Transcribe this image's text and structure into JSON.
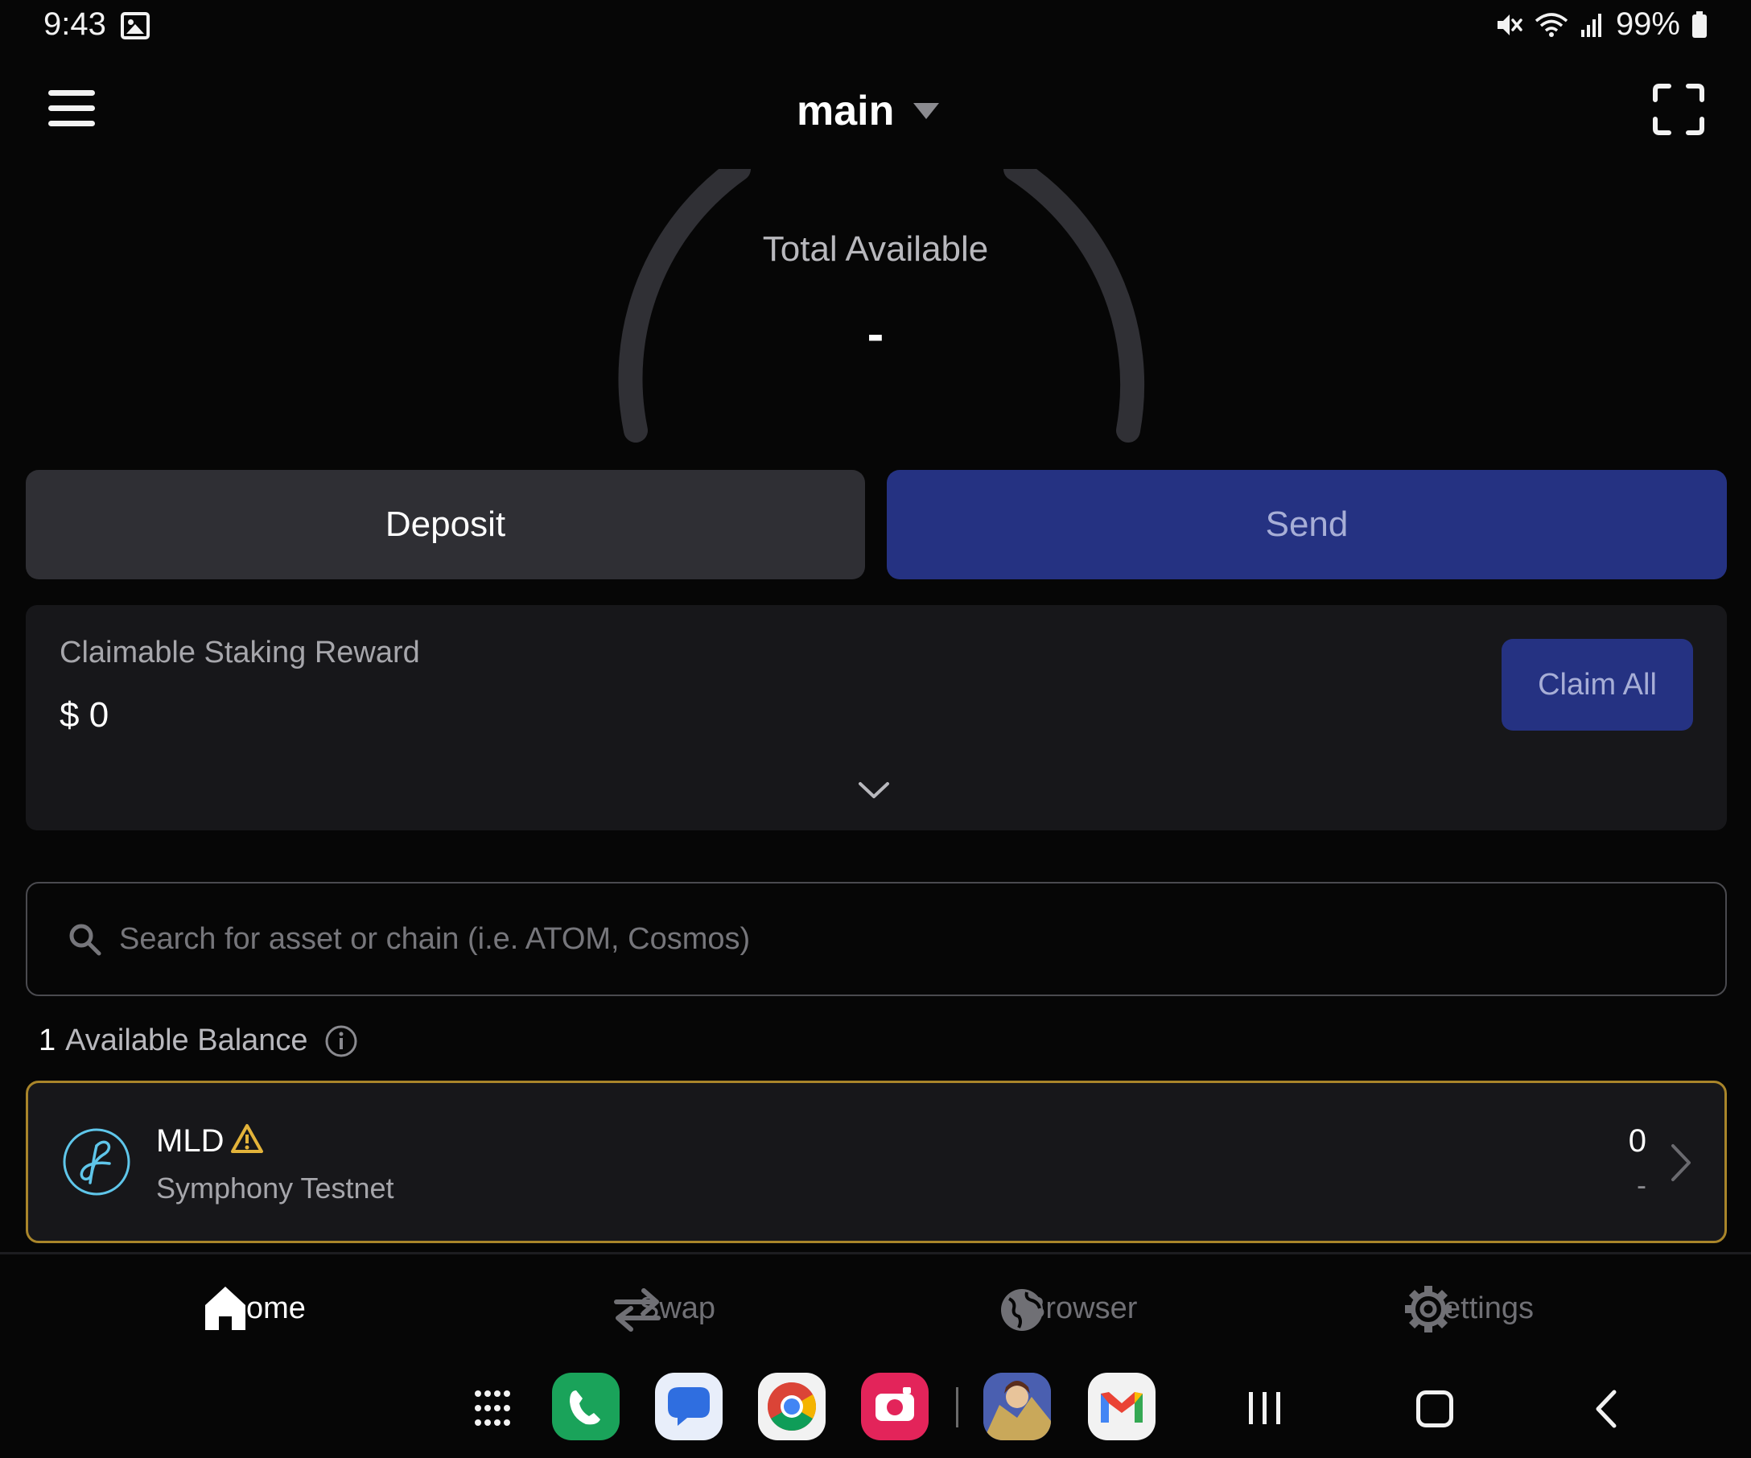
{
  "status_bar": {
    "time": "9:43",
    "battery": "99%",
    "icons": [
      "image-icon",
      "mute-icon",
      "wifi-icon",
      "signal-icon",
      "battery-icon"
    ]
  },
  "header": {
    "account_name": "main",
    "menu_icon": "hamburger-menu-icon",
    "scan_icon": "scan-qr-icon"
  },
  "summary": {
    "total_label": "Total Available",
    "total_value": "-"
  },
  "actions": {
    "deposit_label": "Deposit",
    "send_label": "Send"
  },
  "staking": {
    "label": "Claimable Staking Reward",
    "value": "$ 0",
    "claim_label": "Claim All"
  },
  "search": {
    "placeholder": "Search for asset or chain (i.e. ATOM, Cosmos)",
    "value": ""
  },
  "balances": {
    "count": "1",
    "label": "Available Balance",
    "items": [
      {
        "symbol": "MLD",
        "chain": "Symphony Testnet",
        "amount": "0",
        "value": "-",
        "warning": true
      }
    ]
  },
  "tabs": [
    {
      "label": "Home",
      "visible_label": "ome",
      "icon": "home-icon",
      "active": true
    },
    {
      "label": "Swap",
      "visible_label": "Swap",
      "icon": "swap-icon",
      "active": false
    },
    {
      "label": "Browser",
      "visible_label": "Browser",
      "icon": "globe-icon",
      "active": false
    },
    {
      "label": "Settings",
      "visible_label": "ettings",
      "icon": "gear-icon",
      "active": false
    }
  ],
  "dock": {
    "apps": [
      "phone-app",
      "messages-app",
      "chrome-app",
      "camera-app",
      "game-app",
      "gmail-app"
    ]
  },
  "colors": {
    "background": "#060606",
    "card": "#17171a",
    "primary": "#253282",
    "primary_text": "#a7aed6",
    "warning": "#e3b33a",
    "highlight_border": "#a9852a"
  }
}
